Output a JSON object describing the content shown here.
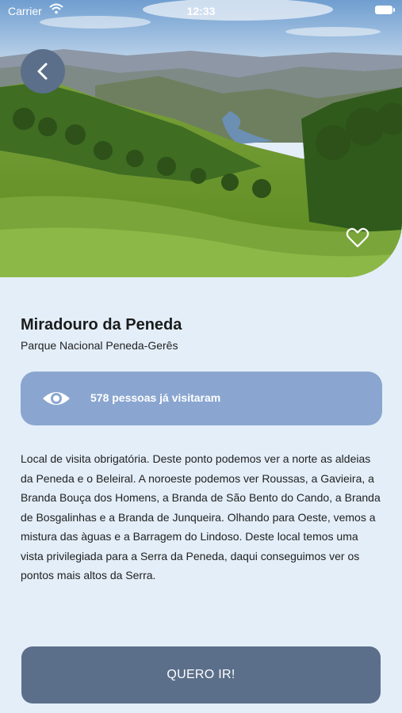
{
  "status_bar": {
    "carrier": "Carrier",
    "time": "12:33"
  },
  "hero": {
    "icons": {
      "back": "chevron-left-icon",
      "favorite": "heart-outline-icon"
    }
  },
  "place": {
    "name": "Miradouro da Peneda",
    "park": "Parque Nacional Peneda-Gerês"
  },
  "visits": {
    "icon": "eye-icon",
    "text": "578 pessoas já visitaram"
  },
  "description": "Local de visita obrigatória. Deste ponto podemos ver a norte as aldeias da Peneda e o Beleiral. A noroeste podemos ver Roussas, a Gavieira, a Branda Bouça dos Homens, a Branda de São Bento do Cando, a Branda de Bosgalinhas e a Branda de Junqueira. Olhando para Oeste, vemos a mistura das àguas e a Barragem do Lindoso. Deste local temos uma vista privilegiada para a Serra da Peneda, daqui conseguimos ver os pontos mais altos da Serra.",
  "cta": {
    "label": "QUERO IR!"
  },
  "colors": {
    "background": "#e3eef8",
    "accent": "#5b6f8a",
    "card": "#8aa6d0"
  }
}
